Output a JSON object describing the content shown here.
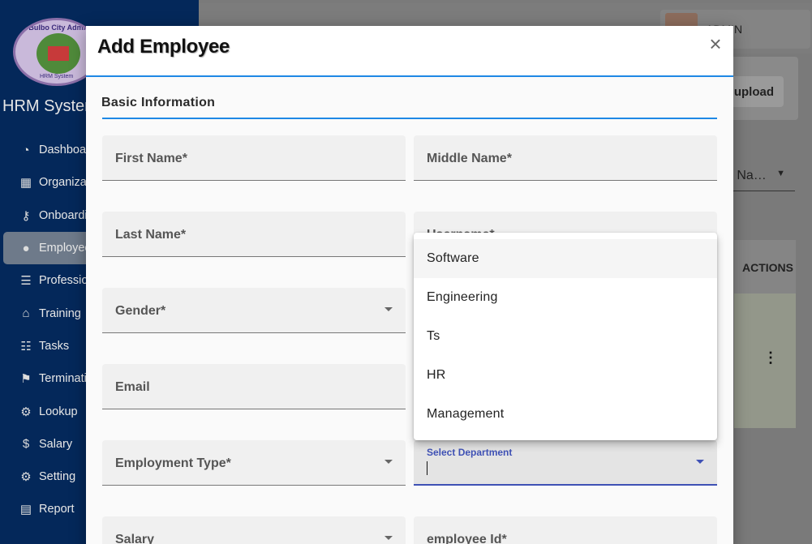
{
  "app": {
    "brand": "HRM System",
    "logo_text": "Bulbo City Admin",
    "logo_subtext": "HRM System",
    "admin_name": "ADMIN",
    "upload_label": "upload",
    "name_select_value": "e Na…",
    "actions_header": "ACTIONS",
    "kebab_glyph": "⋮"
  },
  "sidebar": {
    "items": [
      {
        "label": "Dashboard",
        "icon": "dashboard-icon",
        "glyph": "◔"
      },
      {
        "label": "Organization",
        "icon": "building-icon",
        "glyph": "▦"
      },
      {
        "label": "Onboarding",
        "icon": "key-icon",
        "glyph": "⚷"
      },
      {
        "label": "Employee",
        "icon": "user-icon",
        "glyph": "●",
        "active": true
      },
      {
        "label": "Professional",
        "icon": "list-icon",
        "glyph": "☰"
      },
      {
        "label": "Training",
        "icon": "graduation-cap-icon",
        "glyph": "⌂"
      },
      {
        "label": "Tasks",
        "icon": "tasks-icon",
        "glyph": "☷"
      },
      {
        "label": "Termination",
        "icon": "flag-checkered-icon",
        "glyph": "⚑"
      },
      {
        "label": "Lookup",
        "icon": "gear-icon",
        "glyph": "⚙"
      },
      {
        "label": "Salary",
        "icon": "dollar-icon",
        "glyph": "$"
      },
      {
        "label": "Setting",
        "icon": "gears-icon",
        "glyph": "⚙"
      },
      {
        "label": "Report",
        "icon": "file-icon",
        "glyph": "▤"
      }
    ]
  },
  "modal": {
    "title": "Add Employee",
    "close_glyph": "×",
    "section_title": "Basic Information",
    "fields": {
      "first_name": "First Name*",
      "middle_name": "Middle Name*",
      "last_name": "Last Name*",
      "username": "Username*",
      "gender": "Gender*",
      "email": "Email",
      "employment_type": "Employment Type*",
      "department_label": "Select Department",
      "salary": "Salary",
      "employee_id": "employee Id*"
    }
  },
  "department_menu": {
    "options": [
      "Software",
      "Engineering",
      "Ts",
      "HR",
      "Management"
    ],
    "highlighted": "Software"
  },
  "colors": {
    "accent": "#1e88e5",
    "focus": "#3f51b5",
    "sidebar": "#04285a"
  }
}
